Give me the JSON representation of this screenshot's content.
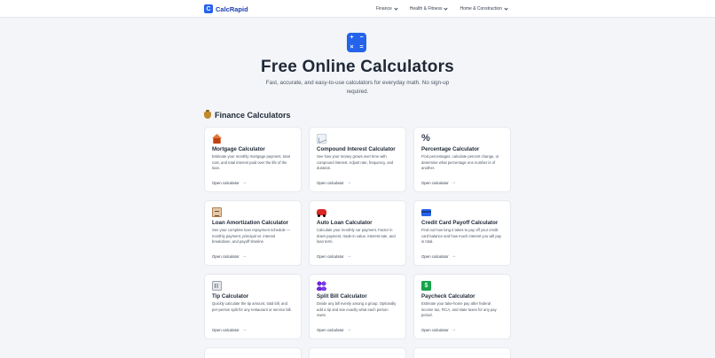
{
  "logo": {
    "text": "CalcRapid",
    "glyph": "C"
  },
  "nav": [
    {
      "label": "Finance"
    },
    {
      "label": "Health & Fitness"
    },
    {
      "label": "Home & Construction"
    }
  ],
  "hero": {
    "icon_glyphs": [
      "+",
      "−",
      "×",
      "="
    ],
    "title": "Free Online Calculators",
    "subtitle": "Fast, accurate, and easy-to-use calculators for everyday math. No sign-up required."
  },
  "section": {
    "title": "Finance Calculators",
    "icon": "money-bag-icon"
  },
  "link_label": "Open calculator",
  "link_arrow": "→",
  "cards": [
    {
      "title": "Mortgage Calculator",
      "icon": "house-icon",
      "desc": "Estimate your monthly mortgage payment, total cost, and total interest paid over the life of the loan."
    },
    {
      "title": "Compound Interest Calculator",
      "icon": "growth-chart-icon",
      "desc": "See how your money grows over time with compound interest. Adjust rate, frequency, and duration."
    },
    {
      "title": "Percentage Calculator",
      "icon": "percent-icon",
      "desc": "Find percentages, calculate percent change, or determine what percentage one number is of another."
    },
    {
      "title": "Loan Amortization Calculator",
      "icon": "clipboard-icon",
      "desc": "See your complete loan repayment schedule — monthly payment, principal vs. interest breakdown, and payoff timeline."
    },
    {
      "title": "Auto Loan Calculator",
      "icon": "car-icon",
      "desc": "Calculate your monthly car payment. Factor in down payment, trade-in value, interest rate, and loan term."
    },
    {
      "title": "Credit Card Payoff Calculator",
      "icon": "credit-card-icon",
      "desc": "Find out how long it takes to pay off your credit card balance and how much interest you will pay in total."
    },
    {
      "title": "Tip Calculator",
      "icon": "receipt-icon",
      "desc": "Quickly calculate the tip amount, total bill, and per-person split for any restaurant or service bill."
    },
    {
      "title": "Split Bill Calculator",
      "icon": "people-icon",
      "desc": "Divide any bill evenly among a group. Optionally add a tip and see exactly what each person owes."
    },
    {
      "title": "Paycheck Calculator",
      "icon": "money-icon",
      "desc": "Estimate your take-home pay after federal income tax, FICA, and state taxes for any pay period."
    }
  ]
}
